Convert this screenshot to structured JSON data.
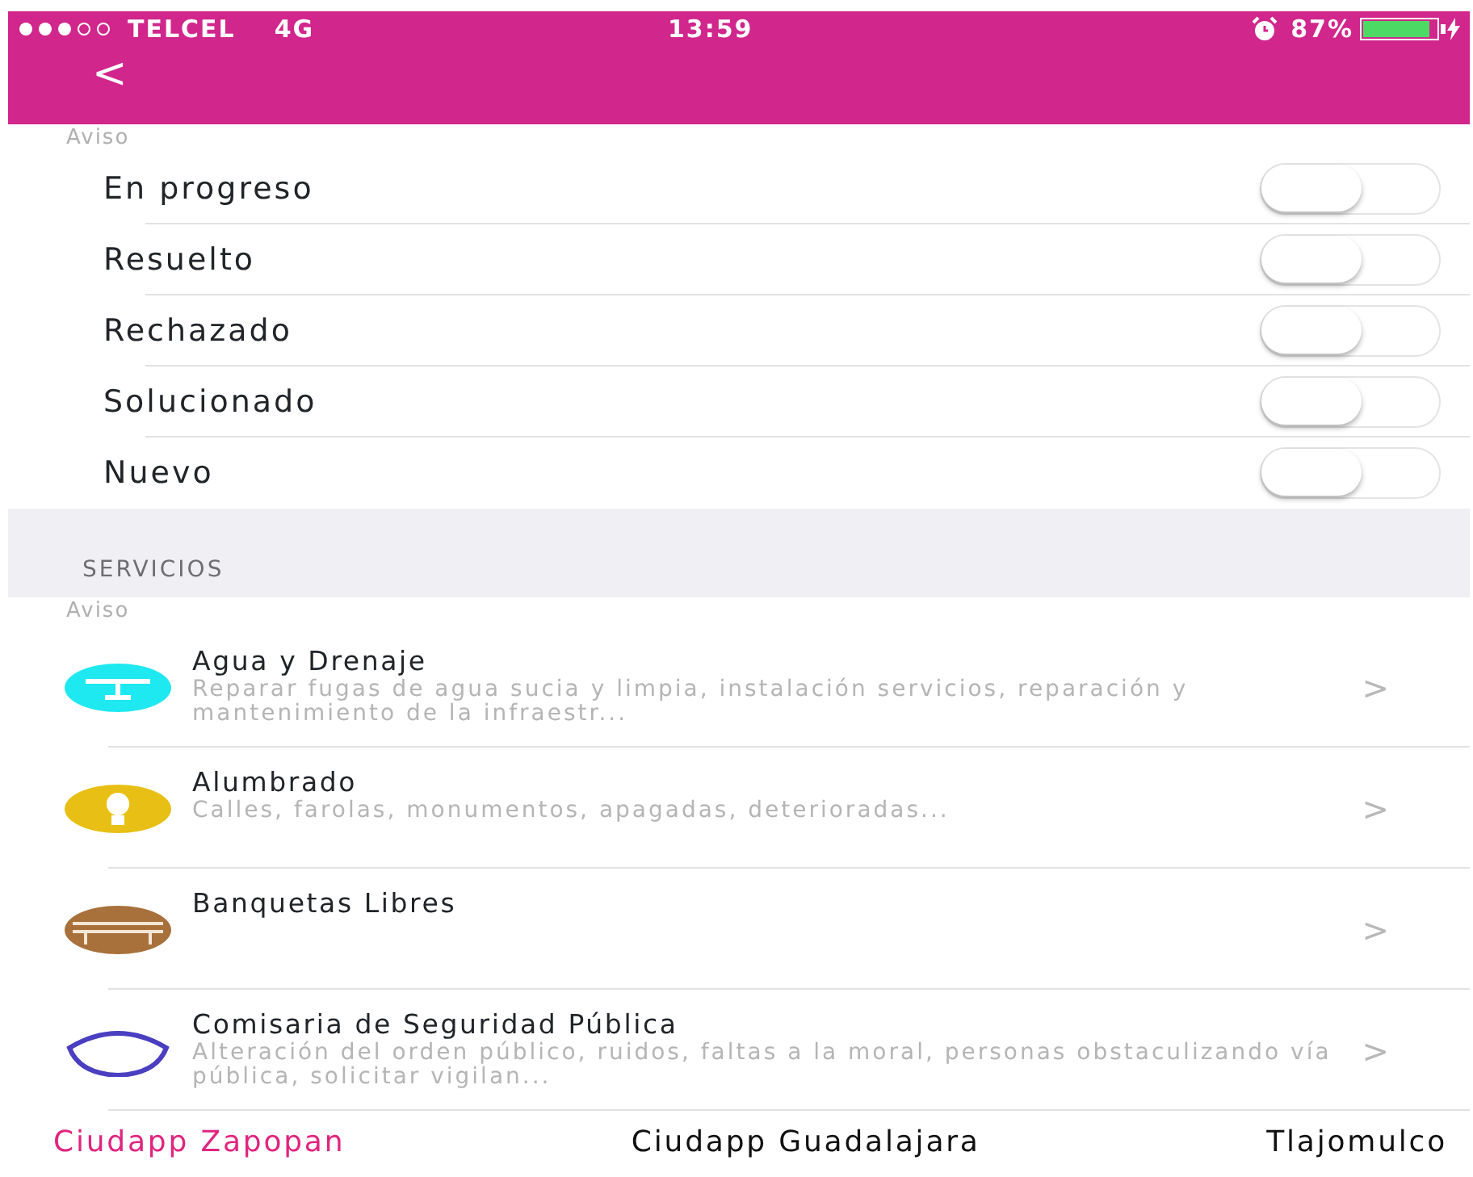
{
  "status_bar": {
    "carrier": "TELCEL",
    "network": "4G",
    "time": "13:59",
    "battery": "87%"
  },
  "nav": {
    "back": "<"
  },
  "filters": {
    "caption": "Aviso",
    "items": [
      {
        "label": "En progreso",
        "on": false
      },
      {
        "label": "Resuelto",
        "on": false
      },
      {
        "label": "Rechazado",
        "on": false
      },
      {
        "label": "Solucionado",
        "on": false
      },
      {
        "label": "Nuevo",
        "on": false
      }
    ]
  },
  "services": {
    "header": "SERVICIOS",
    "caption": "Aviso",
    "items": [
      {
        "title": "Agua y Drenaje",
        "description": "Reparar fugas de agua sucia y limpia, instalación servicios, reparación y mantenimiento de la infraestr...",
        "color": "#1ee8f0",
        "chevron": ">"
      },
      {
        "title": "Alumbrado",
        "description": "Calles, farolas, monumentos, apagadas, deterioradas...",
        "color": "#e8c015",
        "chevron": ">"
      },
      {
        "title": "Banquetas Libres",
        "color": "#a8703a",
        "chevron": ">"
      },
      {
        "title": "Comisaria de Seguridad Pública",
        "description": "Alteración del orden público, ruidos, faltas a la moral, personas obstaculizando vía pública, solicitar vigilan...",
        "color": "#4a3fc0",
        "chevron": ">"
      }
    ]
  },
  "tabs": [
    {
      "label": "Ciudapp Zapopan",
      "selected": true
    },
    {
      "label": "Ciudapp Guadalajara",
      "selected": false
    },
    {
      "label": "Tlajomulco",
      "selected": false
    }
  ]
}
